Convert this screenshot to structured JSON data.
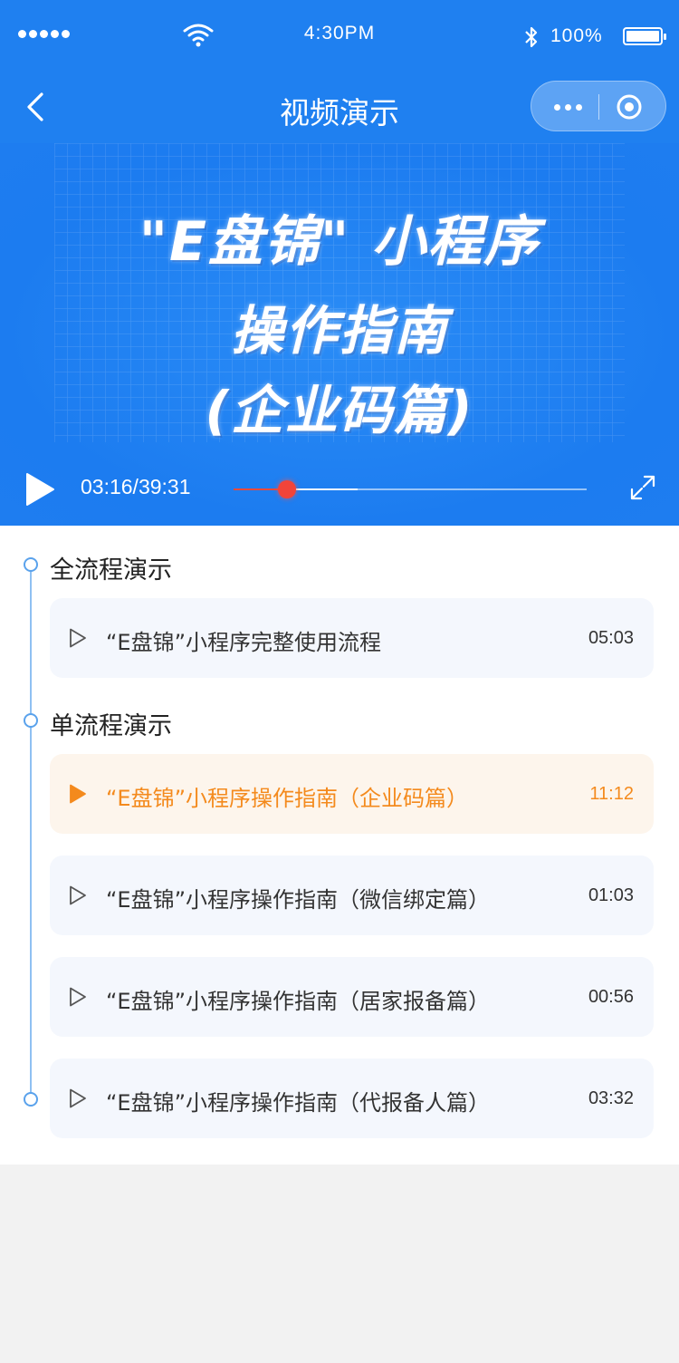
{
  "status_bar": {
    "time": "4:30PM",
    "battery": "100%",
    "icons": [
      "signal-dots-icon",
      "wifi-icon",
      "bluetooth-icon",
      "battery-icon"
    ]
  },
  "nav": {
    "title": "视频演示",
    "icons": [
      "back-arrow-icon",
      "more-dots-icon",
      "target-icon"
    ]
  },
  "video": {
    "title_line1": "\"E盘锦\" 小程序",
    "title_line2": "操作指南",
    "title_line3": "(企业码篇)",
    "current_time": "03:16",
    "total_time": "39:31",
    "time_display": "03:16/39:31",
    "progress": 0.15,
    "buffered": 0.35,
    "icons": [
      "play-icon",
      "fullscreen-icon"
    ]
  },
  "sections": [
    {
      "title": "全流程演示",
      "items": [
        {
          "label": "“E盘锦”小程序完整使用流程",
          "duration": "05:03",
          "active": false
        }
      ]
    },
    {
      "title": "单流程演示",
      "items": [
        {
          "label": "“E盘锦”小程序操作指南（企业码篇）",
          "duration": "11:12",
          "active": true
        },
        {
          "label": "“E盘锦”小程序操作指南（微信绑定篇）",
          "duration": "01:03",
          "active": false
        },
        {
          "label": "“E盘锦”小程序操作指南（居家报备篇）",
          "duration": "00:56",
          "active": false
        },
        {
          "label": "“E盘锦”小程序操作指南（代报备人篇）",
          "duration": "03:32",
          "active": false
        }
      ]
    }
  ],
  "colors": {
    "primary_blue": "#1f80f0",
    "accent_orange": "#f48a1d",
    "progress_red": "#f2443a",
    "item_bg": "#f4f7fd",
    "active_item_bg": "#fdf5ec"
  }
}
